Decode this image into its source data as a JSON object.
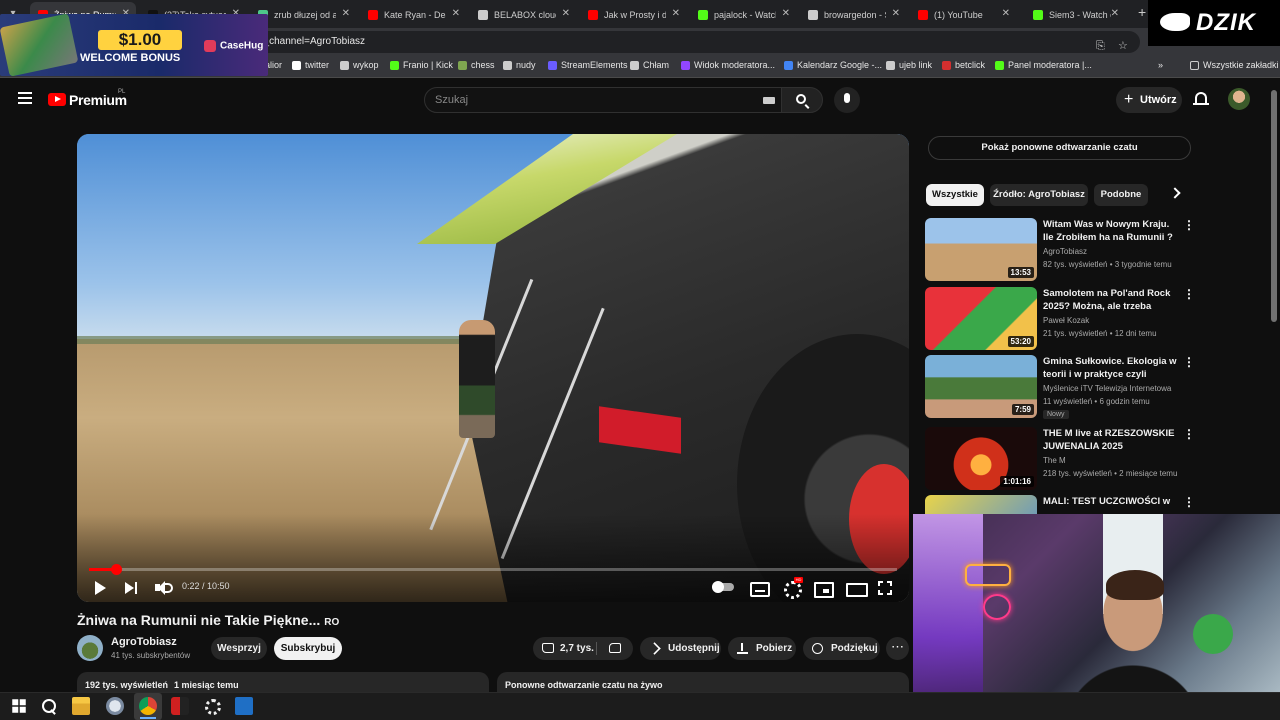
{
  "browser": {
    "tabs": [
      {
        "title": "Żniwa na Rumunii",
        "color": "#ff0000",
        "active": true
      },
      {
        "title": "(37)Taka sytuacja",
        "color": "#111111"
      },
      {
        "title": "zrub dłuzej od a",
        "color": "#4ec78a"
      },
      {
        "title": "Kate Ryan - Dese",
        "color": "#ff0000"
      },
      {
        "title": "BELABOX cloud",
        "color": "#cccccc"
      },
      {
        "title": "Jak w Prosty i do",
        "color": "#ff0000"
      },
      {
        "title": "pajalock - Watch",
        "color": "#53fc18"
      },
      {
        "title": "browargedon - S",
        "color": "#cccccc"
      },
      {
        "title": "(1) YouTube",
        "color": "#ff0000"
      },
      {
        "title": "Siem3 - Watch cl",
        "color": "#53fc18"
      }
    ],
    "url": "b_channel=AgroTobiasz",
    "bookmarks": [
      {
        "label": "alior",
        "color": "#c0392b"
      },
      {
        "label": "twitter",
        "color": "#ffffff"
      },
      {
        "label": "wykop",
        "color": "#cccccc"
      },
      {
        "label": "Franio | Kick",
        "color": "#53fc18"
      },
      {
        "label": "chess",
        "color": "#7fa650"
      },
      {
        "label": "nudy",
        "color": "#cccccc"
      },
      {
        "label": "StreamElements",
        "color": "#6a5cff"
      },
      {
        "label": "Chłam",
        "color": "#cccccc"
      },
      {
        "label": "Widok moderatora...",
        "color": "#9146ff"
      },
      {
        "label": "Kalendarz Google -...",
        "color": "#4285f4"
      },
      {
        "label": "ujeb link",
        "color": "#cccccc"
      },
      {
        "label": "betclick",
        "color": "#d32f2f"
      },
      {
        "label": "Panel moderatora |...",
        "color": "#53fc18"
      }
    ],
    "all_bookmarks": "Wszystkie zakładki"
  },
  "promo": {
    "amount": "$1.00",
    "bonus": "WELCOME BONUS",
    "brand": "CaseHug"
  },
  "stream_logo": "DZIK",
  "youtube": {
    "logo_text": "Premium",
    "country": "PL",
    "search_placeholder": "Szukaj",
    "create_label": "Utwórz"
  },
  "player": {
    "current_time": "0:22",
    "duration": "10:50",
    "time_display": "0:22 / 10:50",
    "progress_fraction": 0.034
  },
  "video": {
    "title": "Żniwa na Rumunii nie Takie Piękne...",
    "title_suffix": "RO",
    "channel": "AgroTobiasz",
    "subscribers": "41 tys. subskrybentów",
    "support_label": "Wesprzyj",
    "subscribe_label": "Subskrybuj",
    "likes": "2,7 tys.",
    "share_label": "Udostępnij",
    "download_label": "Pobierz",
    "thanks_label": "Podziękuj",
    "views": "192 tys. wyświetleń",
    "age": "1 miesiąc temu",
    "chat_replay_panel": "Ponowne odtwarzanie czatu na żywo"
  },
  "sidebar": {
    "chat_replay_button": "Pokaż ponowne odtwarzanie czatu",
    "chips": [
      "Wszystkie",
      "Źródło: AgroTobiasz",
      "Podobne"
    ],
    "recommendations": [
      {
        "title": "Witam Was w Nowym Kraju. Ile Zrobiłem ha na Rumunii ?",
        "channel": "AgroTobiasz",
        "meta": "82 tys. wyświetleń • 3 tygodnie temu",
        "duration": "13:53",
        "thumb": "linear-gradient(180deg,#9cc3ea 0 40%,#c8a070 41%)"
      },
      {
        "title": "Samolotem na Pol'and Rock 2025? Można, ale trzeba bardz...",
        "channel": "Paweł Kozak",
        "meta": "21 tys. wyświetleń • 12 dni temu",
        "duration": "53:20",
        "thumb": "linear-gradient(135deg,#e8323a 0 40%,#3aa84a 41% 70%,#f2c14a 71%)"
      },
      {
        "title": "Gmina Sułkowice. Ekologia w teorii i w praktyce czyli ekoStr...",
        "channel": "Myślenice iTV Telewizja Internetowa",
        "meta": "11 wyświetleń • 6 godzin temu",
        "duration": "7:59",
        "badge": "Nowy",
        "thumb": "linear-gradient(180deg,#7ab0d8 0 35%,#4a7a3a 36% 70%,#c89a7a 71%)"
      },
      {
        "title": "THE M live at RZESZOWSKIE JUWENALIA 2025",
        "channel": "The M",
        "meta": "218 tys. wyświetleń • 2 miesiące temu",
        "duration": "1:01:16",
        "thumb": "radial-gradient(circle at 50% 60%,#ffb040 0 15%,#d0301a 16% 40%,#1a0a0a 41%)"
      },
      {
        "title": "MALI: TEST UCZCIWOŚCI w",
        "channel": "",
        "meta": "",
        "duration": "",
        "thumb": "linear-gradient(135deg,#e8d44a,#4a8ad8)"
      }
    ]
  }
}
